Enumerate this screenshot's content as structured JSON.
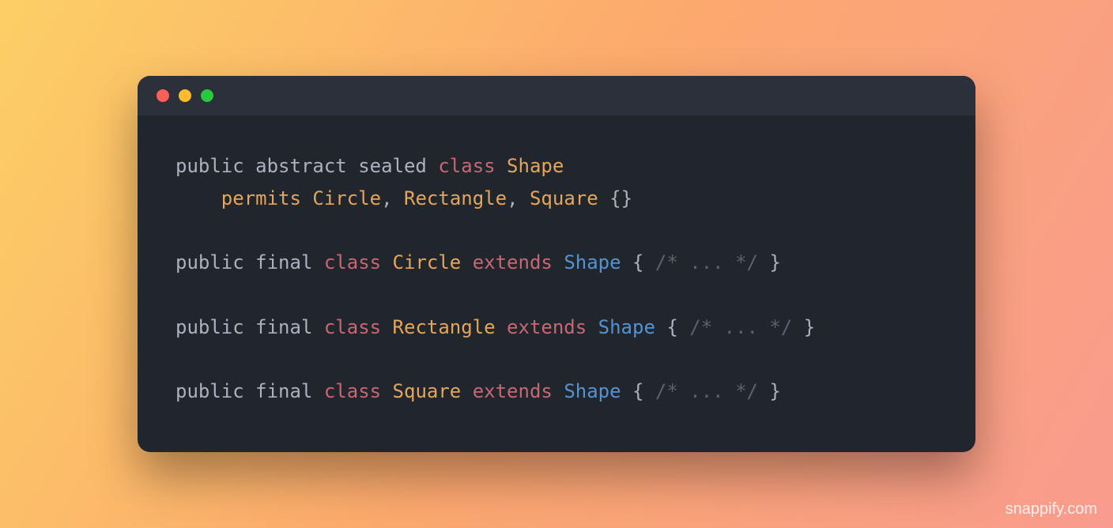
{
  "watermark": "snappify.com",
  "code": {
    "lines": [
      [
        {
          "cls": "tok-plain",
          "text": "public abstract sealed "
        },
        {
          "cls": "tok-keyword",
          "text": "class"
        },
        {
          "cls": "tok-plain",
          "text": " "
        },
        {
          "cls": "tok-type",
          "text": "Shape"
        }
      ],
      [
        {
          "cls": "tok-plain",
          "text": "    "
        },
        {
          "cls": "tok-type",
          "text": "permits"
        },
        {
          "cls": "tok-plain",
          "text": " "
        },
        {
          "cls": "tok-type",
          "text": "Circle"
        },
        {
          "cls": "tok-punct",
          "text": ", "
        },
        {
          "cls": "tok-type",
          "text": "Rectangle"
        },
        {
          "cls": "tok-punct",
          "text": ", "
        },
        {
          "cls": "tok-type",
          "text": "Square"
        },
        {
          "cls": "tok-punct",
          "text": " {}"
        }
      ],
      [],
      [
        {
          "cls": "tok-plain",
          "text": "public final "
        },
        {
          "cls": "tok-keyword",
          "text": "class"
        },
        {
          "cls": "tok-plain",
          "text": " "
        },
        {
          "cls": "tok-type",
          "text": "Circle"
        },
        {
          "cls": "tok-plain",
          "text": " "
        },
        {
          "cls": "tok-keyword",
          "text": "extends"
        },
        {
          "cls": "tok-plain",
          "text": " "
        },
        {
          "cls": "tok-type2",
          "text": "Shape"
        },
        {
          "cls": "tok-punct",
          "text": " { "
        },
        {
          "cls": "tok-comment",
          "text": "/* ... */"
        },
        {
          "cls": "tok-punct",
          "text": " }"
        }
      ],
      [],
      [
        {
          "cls": "tok-plain",
          "text": "public final "
        },
        {
          "cls": "tok-keyword",
          "text": "class"
        },
        {
          "cls": "tok-plain",
          "text": " "
        },
        {
          "cls": "tok-type",
          "text": "Rectangle"
        },
        {
          "cls": "tok-plain",
          "text": " "
        },
        {
          "cls": "tok-keyword",
          "text": "extends"
        },
        {
          "cls": "tok-plain",
          "text": " "
        },
        {
          "cls": "tok-type2",
          "text": "Shape"
        },
        {
          "cls": "tok-punct",
          "text": " { "
        },
        {
          "cls": "tok-comment",
          "text": "/* ... */"
        },
        {
          "cls": "tok-punct",
          "text": " }"
        }
      ],
      [],
      [
        {
          "cls": "tok-plain",
          "text": "public final "
        },
        {
          "cls": "tok-keyword",
          "text": "class"
        },
        {
          "cls": "tok-plain",
          "text": " "
        },
        {
          "cls": "tok-type",
          "text": "Square"
        },
        {
          "cls": "tok-plain",
          "text": " "
        },
        {
          "cls": "tok-keyword",
          "text": "extends"
        },
        {
          "cls": "tok-plain",
          "text": " "
        },
        {
          "cls": "tok-type2",
          "text": "Shape"
        },
        {
          "cls": "tok-punct",
          "text": " { "
        },
        {
          "cls": "tok-comment",
          "text": "/* ... */"
        },
        {
          "cls": "tok-punct",
          "text": " }"
        }
      ]
    ]
  }
}
